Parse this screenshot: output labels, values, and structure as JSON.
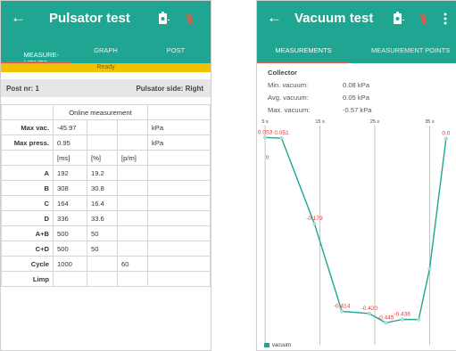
{
  "colors": {
    "primary": "#1fa591",
    "accent": "#e35b45",
    "status_ready": "#f2c200",
    "data_label": "#e53935"
  },
  "left": {
    "title": "Pulsator test",
    "icons": {
      "back": "arrow-back-icon",
      "device": "device-battery-icon",
      "bluetooth": "bluetooth-off-icon"
    },
    "tabs": [
      {
        "label": "MEASURE-\nMENTS",
        "active": true
      },
      {
        "label": "GRAPH",
        "active": false
      },
      {
        "label": "POST",
        "active": false
      }
    ],
    "status": "Ready",
    "post_nr": "Post nr: 1",
    "pulsator_side": "Pulsator side: Right",
    "online_header": "Online measurement",
    "max_vac": {
      "label": "Max vac.",
      "value": "-45.97",
      "unit": "kPa"
    },
    "max_press": {
      "label": "Max press.",
      "value": "0.95",
      "unit": "kPa"
    },
    "units": [
      "[ms]",
      "[%]",
      "[p/m]"
    ],
    "rows": [
      {
        "label": "A",
        "ms": "192",
        "pct": "19.2",
        "ppm": ""
      },
      {
        "label": "B",
        "ms": "308",
        "pct": "30.8",
        "ppm": ""
      },
      {
        "label": "C",
        "ms": "164",
        "pct": "16.4",
        "ppm": ""
      },
      {
        "label": "D",
        "ms": "336",
        "pct": "33.6",
        "ppm": ""
      },
      {
        "label": "A+B",
        "ms": "500",
        "pct": "50",
        "ppm": ""
      },
      {
        "label": "C+D",
        "ms": "500",
        "pct": "50",
        "ppm": ""
      },
      {
        "label": "Cycle",
        "ms": "1000",
        "pct": "",
        "ppm": "60"
      },
      {
        "label": "Limp",
        "ms": "",
        "pct": "",
        "ppm": ""
      }
    ]
  },
  "right": {
    "title": "Vacuum test",
    "icons": {
      "back": "arrow-back-icon",
      "device": "device-battery-icon",
      "bluetooth": "bluetooth-off-icon",
      "more": "more-vert-icon"
    },
    "tabs": [
      {
        "label": "MEASUREMENTS",
        "active": true
      },
      {
        "label": "MEASUREMENT POINTS",
        "active": false
      }
    ],
    "collector": "Collector",
    "min_vacuum": {
      "label": "Min. vacuum:",
      "value": "0.08 kPa"
    },
    "avg_vacuum": {
      "label": "Avg. vacuum:",
      "value": "0.05 kPa"
    },
    "max_vacuum": {
      "label": "Max. vacuum:",
      "value": "-0.57 kPa"
    }
  },
  "chart_data": {
    "type": "line",
    "series": [
      {
        "name": "vacuum",
        "x": [
          5,
          8,
          14,
          19,
          24,
          27,
          30,
          33,
          35,
          38
        ],
        "values": [
          0.053,
          0.051,
          -0.179,
          -0.414,
          -0.42,
          -0.445,
          -0.436,
          -0.436,
          -0.3,
          0.05
        ]
      }
    ],
    "point_labels": [
      "0.053",
      "0.051",
      "-0.179",
      "-0.414",
      "-0.420",
      "-0.445",
      "-0.436",
      "",
      "",
      "0.0"
    ],
    "x_ticks": [
      {
        "value": 5,
        "label": "5 s"
      },
      {
        "value": 15,
        "label": "15 s"
      },
      {
        "value": 25,
        "label": "25 s"
      },
      {
        "value": 35,
        "label": "35 s"
      }
    ],
    "y_ticks": [
      {
        "value": 0,
        "label": "0"
      }
    ],
    "xlim": [
      4.5,
      39
    ],
    "ylim": [
      -0.48,
      0.08
    ],
    "legend": "bottom-left",
    "grid": "vertical"
  }
}
